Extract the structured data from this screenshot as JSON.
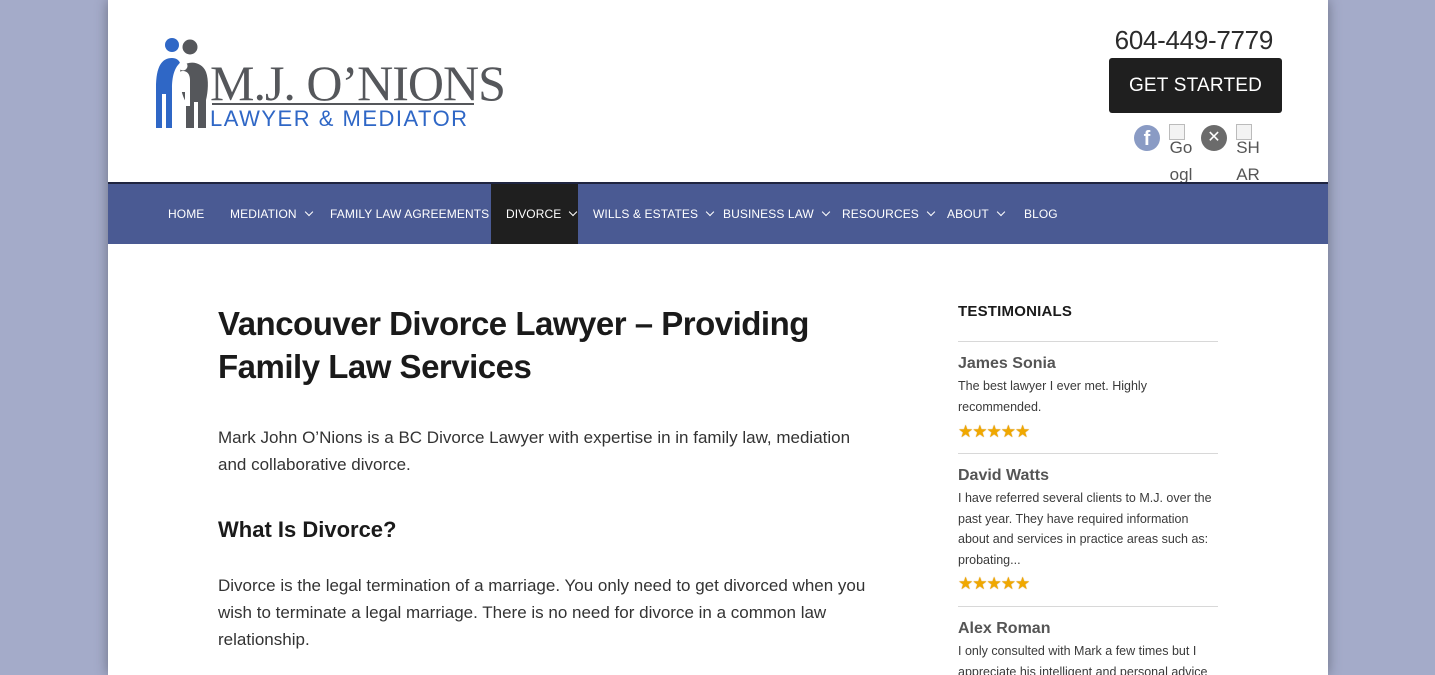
{
  "header": {
    "logo": {
      "name": "M.J. O’NIONS",
      "tagline": "LAWYER & MEDIATOR",
      "brand_color": "#2f67c6",
      "name_color": "#55575b"
    },
    "phone": "604-449-7779",
    "cta_label": "GET STARTED",
    "social": [
      {
        "icon": "facebook-icon",
        "alt": ""
      },
      {
        "icon": "google-plus-icon",
        "alt": "Google+"
      },
      {
        "icon": "x-twitter-icon",
        "alt": ""
      },
      {
        "icon": "share-icon",
        "alt": "SHARE"
      }
    ]
  },
  "nav": {
    "color": "#4a5a93",
    "active_color": "#1f1f1f",
    "items": [
      {
        "label": "HOME"
      },
      {
        "label": "MEDIATION"
      },
      {
        "label": "FAMILY LAW AGREEMENTS"
      },
      {
        "label": "DIVORCE"
      },
      {
        "label": "WILLS & ESTATES"
      },
      {
        "label": "BUSINESS LAW"
      },
      {
        "label": "RESOURCES"
      },
      {
        "label": "ABOUT"
      },
      {
        "label": "BLOG"
      }
    ]
  },
  "main": {
    "title": "Vancouver Divorce Lawyer – Providing Family Law Services",
    "intro": "Mark John O’Nions is a BC Divorce Lawyer with expertise in in family law, mediation and collaborative divorce.",
    "section_heading": "What Is Divorce?",
    "section_text": "Divorce is the legal termination of a marriage. You only need to get divorced when you wish to terminate a legal marriage. There is no need for divorce in a common law relationship."
  },
  "sidebar": {
    "title": "TESTIMONIALS",
    "testimonials": [
      {
        "name": "James Sonia",
        "text": "The best lawyer I ever met. Highly recommended.",
        "rating": 5,
        "rating_max": 5
      },
      {
        "name": "David Watts",
        "text": "I have referred several clients to M.J. over the past year.  They have required information about and services in practice areas such as: probating...",
        "rating": 5,
        "rating_max": 5
      },
      {
        "name": "Alex Roman",
        "text": "I only consulted with Mark a few times but I appreciate his intelligent and personal advice"
      }
    ]
  }
}
